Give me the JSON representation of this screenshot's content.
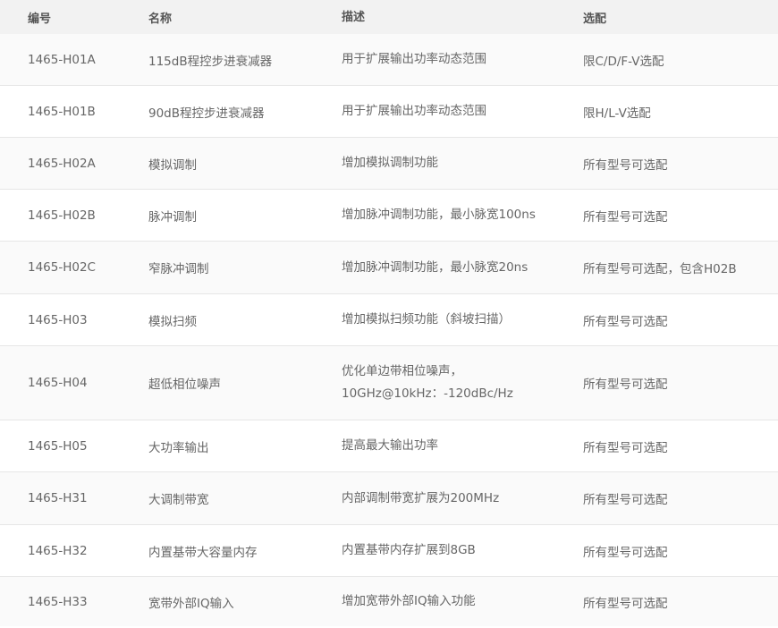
{
  "headers": [
    "编号",
    "名称",
    "描述",
    "选配"
  ],
  "rows": [
    {
      "code": "1465-H01A",
      "name": "115dB程控步进衰减器",
      "desc": [
        "用于扩展输出功率动态范围"
      ],
      "option": "限C/D/F-V选配"
    },
    {
      "code": "1465-H01B",
      "name": "90dB程控步进衰减器",
      "desc": [
        "用于扩展输出功率动态范围"
      ],
      "option": "限H/L-V选配"
    },
    {
      "code": "1465-H02A",
      "name": "模拟调制",
      "desc": [
        "增加模拟调制功能"
      ],
      "option": "所有型号可选配"
    },
    {
      "code": "1465-H02B",
      "name": "脉冲调制",
      "desc": [
        "增加脉冲调制功能，最小脉宽100ns"
      ],
      "option": "所有型号可选配"
    },
    {
      "code": "1465-H02C",
      "name": "窄脉冲调制",
      "desc": [
        "增加脉冲调制功能，最小脉宽20ns"
      ],
      "option": "所有型号可选配，包含H02B"
    },
    {
      "code": "1465-H03",
      "name": "模拟扫频",
      "desc": [
        "增加模拟扫频功能（斜坡扫描）"
      ],
      "option": "所有型号可选配"
    },
    {
      "code": "1465-H04",
      "name": "超低相位噪声",
      "desc": [
        "优化单边带相位噪声，",
        "10GHz@10kHz：-120dBc/Hz"
      ],
      "option": "所有型号可选配"
    },
    {
      "code": "1465-H05",
      "name": "大功率输出",
      "desc": [
        "提高最大输出功率"
      ],
      "option": "所有型号可选配"
    },
    {
      "code": "1465-H31",
      "name": "大调制带宽",
      "desc": [
        "内部调制带宽扩展为200MHz"
      ],
      "option": "所有型号可选配"
    },
    {
      "code": "1465-H32",
      "name": "内置基带大容量内存",
      "desc": [
        "内置基带内存扩展到8GB"
      ],
      "option": "所有型号可选配"
    },
    {
      "code": "1465-H33",
      "name": "宽带外部IQ输入",
      "desc": [
        "增加宽带外部IQ输入功能"
      ],
      "option": "所有型号可选配"
    }
  ]
}
